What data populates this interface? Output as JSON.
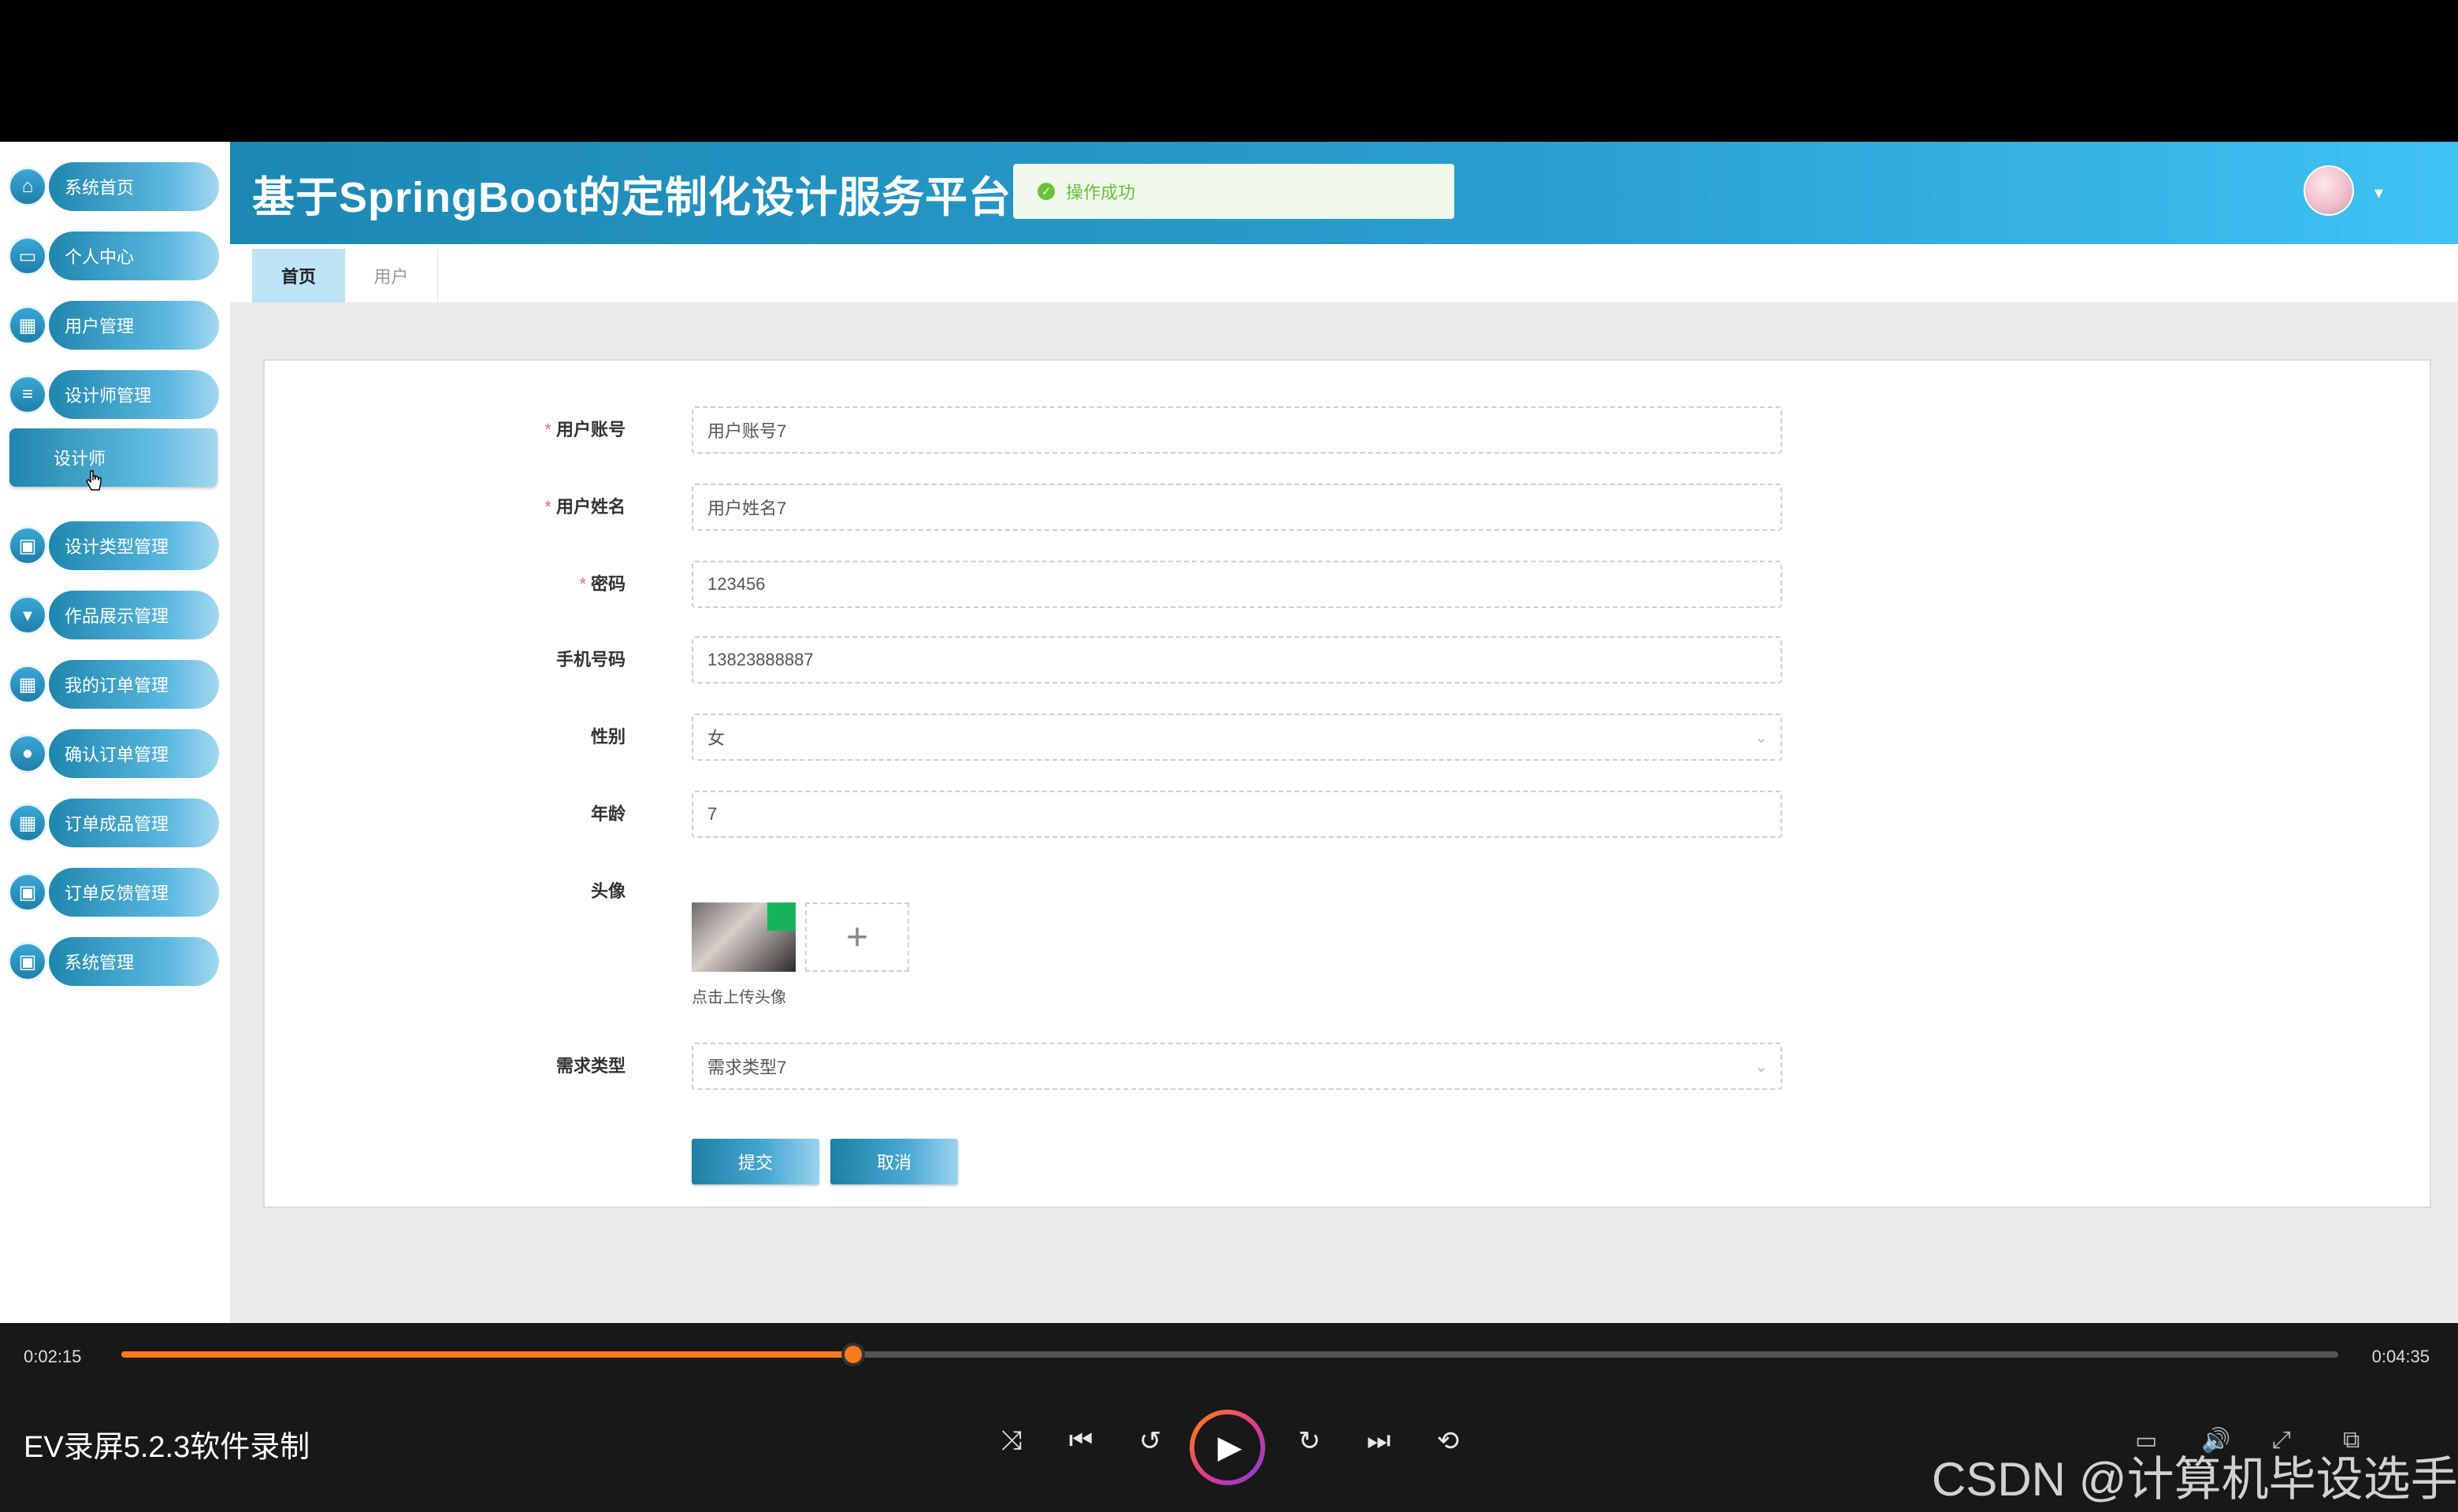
{
  "header": {
    "title": "基于SpringBoot的定制化设计服务平台",
    "toast": "操作成功"
  },
  "sidebar": {
    "items": [
      {
        "label": "系统首页",
        "icon": "home-icon"
      },
      {
        "label": "个人中心",
        "icon": "window-icon"
      },
      {
        "label": "用户管理",
        "icon": "grid-icon"
      },
      {
        "label": "设计师管理",
        "icon": "list-icon"
      },
      {
        "label": "设计类型管理",
        "icon": "clipboard-icon"
      },
      {
        "label": "作品展示管理",
        "icon": "brush-icon"
      },
      {
        "label": "我的订单管理",
        "icon": "grid-icon"
      },
      {
        "label": "确认订单管理",
        "icon": "bulb-icon"
      },
      {
        "label": "订单成品管理",
        "icon": "grid-icon"
      },
      {
        "label": "订单反馈管理",
        "icon": "clipboard-icon"
      },
      {
        "label": "系统管理",
        "icon": "clipboard-icon"
      }
    ],
    "sub_item": "设计师"
  },
  "tabs": [
    {
      "label": "首页",
      "active": true
    },
    {
      "label": "用户",
      "active": false
    }
  ],
  "form": {
    "account": {
      "label": "用户账号",
      "value": "用户账号7",
      "required": true
    },
    "name": {
      "label": "用户姓名",
      "value": "用户姓名7",
      "required": true
    },
    "password": {
      "label": "密码",
      "value": "123456",
      "required": true
    },
    "phone": {
      "label": "手机号码",
      "value": "13823888887",
      "required": false
    },
    "gender": {
      "label": "性别",
      "value": "女",
      "required": false
    },
    "age": {
      "label": "年龄",
      "value": "7",
      "required": false
    },
    "avatar": {
      "label": "头像",
      "hint": "点击上传头像",
      "plus": "+"
    },
    "demand_type": {
      "label": "需求类型",
      "value": "需求类型7",
      "required": false
    },
    "submit": "提交",
    "cancel": "取消"
  },
  "player": {
    "current_time": "0:02:15",
    "total_time": "0:04:35",
    "progress": 0.33,
    "recorder_label": "EV录屏5.2.3软件录制",
    "watermark": "CSDN @计算机毕设选手"
  },
  "colors": {
    "accent": "#1e86ad",
    "header_end": "#3fc2f5",
    "success": "#67c23a",
    "progress": "#ff7a1a"
  }
}
